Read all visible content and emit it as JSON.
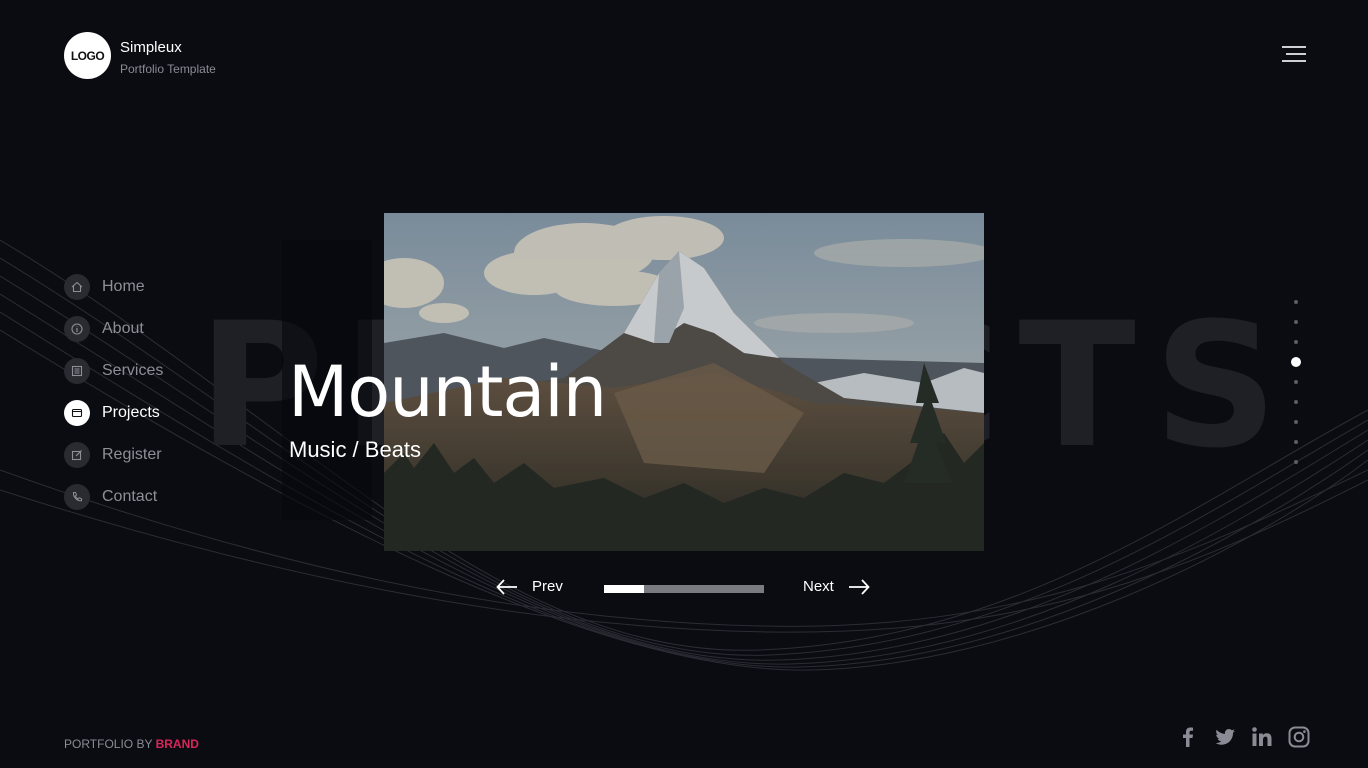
{
  "brand": {
    "logo_text": "LOGO",
    "name": "Simpleux",
    "tagline": "Portfolio Template"
  },
  "background_word": "PROJECTS",
  "nav": {
    "items": [
      {
        "label": "Home",
        "icon": "home-icon"
      },
      {
        "label": "About",
        "icon": "info-icon"
      },
      {
        "label": "Services",
        "icon": "list-icon"
      },
      {
        "label": "Projects",
        "icon": "folder-icon",
        "active": true
      },
      {
        "label": "Register",
        "icon": "edit-icon"
      },
      {
        "label": "Contact",
        "icon": "phone-icon"
      }
    ]
  },
  "slide": {
    "title": "Mountain",
    "subtitle": "Music / Beats",
    "image": "mountain-photo"
  },
  "controls": {
    "prev_label": "Prev",
    "next_label": "Next",
    "progress": 0.25
  },
  "pagination": {
    "total": 9,
    "active_index": 3
  },
  "footer": {
    "prefix": "PORTFOLIO BY",
    "brand": "BRAND",
    "brand_color": "#d8265a"
  },
  "socials": [
    "facebook-icon",
    "twitter-icon",
    "linkedin-icon",
    "instagram-icon"
  ]
}
